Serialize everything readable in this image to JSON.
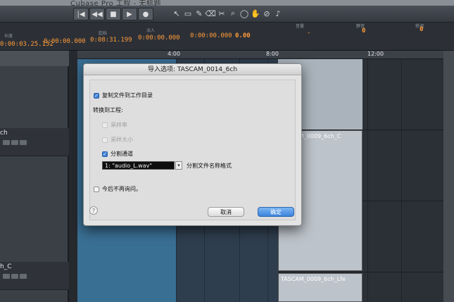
{
  "app": {
    "window_title": "Cubase Pro 工程 - 无标题"
  },
  "transport": {
    "buttons": [
      {
        "icon": "go-to-start-icon",
        "glyph": "|◀"
      },
      {
        "icon": "rewind-icon",
        "glyph": "◀◀"
      },
      {
        "icon": "stop-icon",
        "glyph": "■"
      },
      {
        "icon": "play-icon",
        "glyph": "▶"
      },
      {
        "icon": "record-icon",
        "glyph": "●"
      }
    ]
  },
  "tools": [
    "↖",
    "▭",
    "✎",
    "⌫",
    "✂",
    "⌕",
    "◯",
    "✋",
    "⊘",
    "♪"
  ],
  "control_strip": {
    "left_label": "长度",
    "left_value": "0:00:03.25.152",
    "value2": "0:00:00.000",
    "label3": "起始",
    "value3": "0:08:31.199",
    "label4": "淡入",
    "value4": "0:00:00.000",
    "value5": "0:00:00.000",
    "value6": "0.00",
    "label7": "音量",
    "value7": "-",
    "label8": "静音",
    "value8": "0",
    "label9": "移调",
    "value9": "0"
  },
  "ruler": {
    "marks": [
      "4:00",
      "8:00",
      "12:00"
    ]
  },
  "inspector": {
    "tracks": [
      {
        "name": "ch"
      },
      {
        "name": "h_C"
      }
    ]
  },
  "arrange": {
    "events": [
      {
        "name": "TASCAM_0009_6ch_C"
      },
      {
        "name": "TASCAM_0009_6ch_Lfe"
      }
    ]
  },
  "dialog": {
    "title": "导入选项: TASCAM_0014_6ch",
    "copy_to_project": "复制文件到工作目录",
    "convert_label": "转换到工程:",
    "sample_rate": "采样率",
    "sample_size": "采样大小",
    "split_channels": "分割通道",
    "name_format_value": "1: \"audio_L.wav\"",
    "name_format_label": "分割文件名称格式",
    "dont_ask": "今后不再询问。",
    "help": "?",
    "cancel": "取消",
    "ok": "确定",
    "checked": {
      "copy_to_project": true,
      "sample_rate": false,
      "sample_size": false,
      "split_channels": true,
      "dont_ask": false
    }
  }
}
